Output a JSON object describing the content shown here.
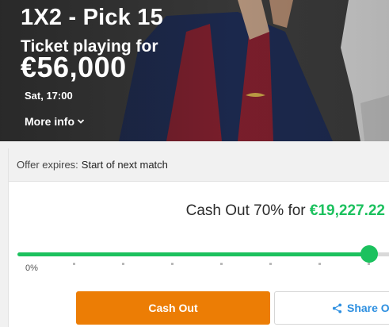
{
  "hero": {
    "title": "1X2 - Pick 15",
    "subtitle": "Ticket playing for",
    "amount": "€56,000",
    "time": "Sat, 17:00",
    "more_info": "More info"
  },
  "offer": {
    "label": "Offer expires:",
    "value": "Start of next match"
  },
  "cashout": {
    "prefix": "Cash Out 70% for",
    "amount": "€19,227.22",
    "percent": 70,
    "min_label": "0%",
    "accent_color": "#1cc15e"
  },
  "buttons": {
    "cash_out": "Cash Out",
    "share": "Share Of",
    "cash_out_color": "#ec7d05",
    "share_color": "#2d8fe0"
  }
}
